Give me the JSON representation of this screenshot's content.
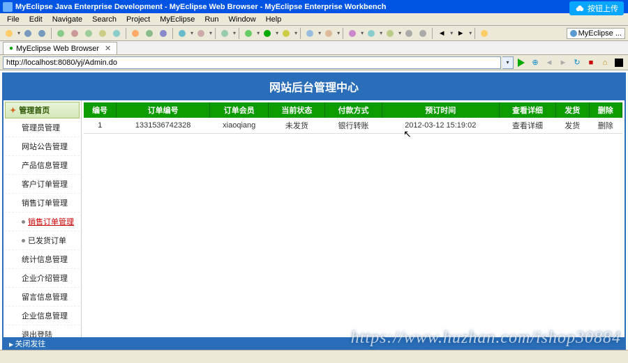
{
  "app": {
    "title": "MyEclipse Java Enterprise Development - MyEclipse Web Browser - MyEclipse Enterprise Workbench",
    "cloud_btn": "按钮上传"
  },
  "menu": [
    "File",
    "Edit",
    "Navigate",
    "Search",
    "Project",
    "MyEclipse",
    "Run",
    "Window",
    "Help"
  ],
  "perspective": "MyEclipse ...",
  "tab": {
    "label": "MyEclipse Web Browser"
  },
  "url": "http://localhost:8080/yj/Admin.do",
  "page": {
    "title": "网站后台管理中心"
  },
  "sidebar": {
    "header": "管理首页",
    "items": [
      "管理员管理",
      "网站公告管理",
      "产品信息管理",
      "客户订单管理",
      "销售订单管理"
    ],
    "subs": [
      "销售订单管理",
      "已发货订单"
    ],
    "items2": [
      "统计信息管理",
      "企业介绍管理",
      "留言信息管理",
      "企业信息管理",
      "退出登陆"
    ]
  },
  "table": {
    "headers": [
      "编号",
      "订单编号",
      "订单会员",
      "当前状态",
      "付款方式",
      "预订时间",
      "查看详细",
      "发货",
      "删除"
    ],
    "row": [
      "1",
      "1331536742328",
      "xiaoqiang",
      "未发货",
      "银行转账",
      "2012-03-12 15:19:02",
      "查看详细",
      "发货",
      "删除"
    ]
  },
  "footer": "关闭发往",
  "watermark": "https://www.huzhan.com/ishop30884"
}
